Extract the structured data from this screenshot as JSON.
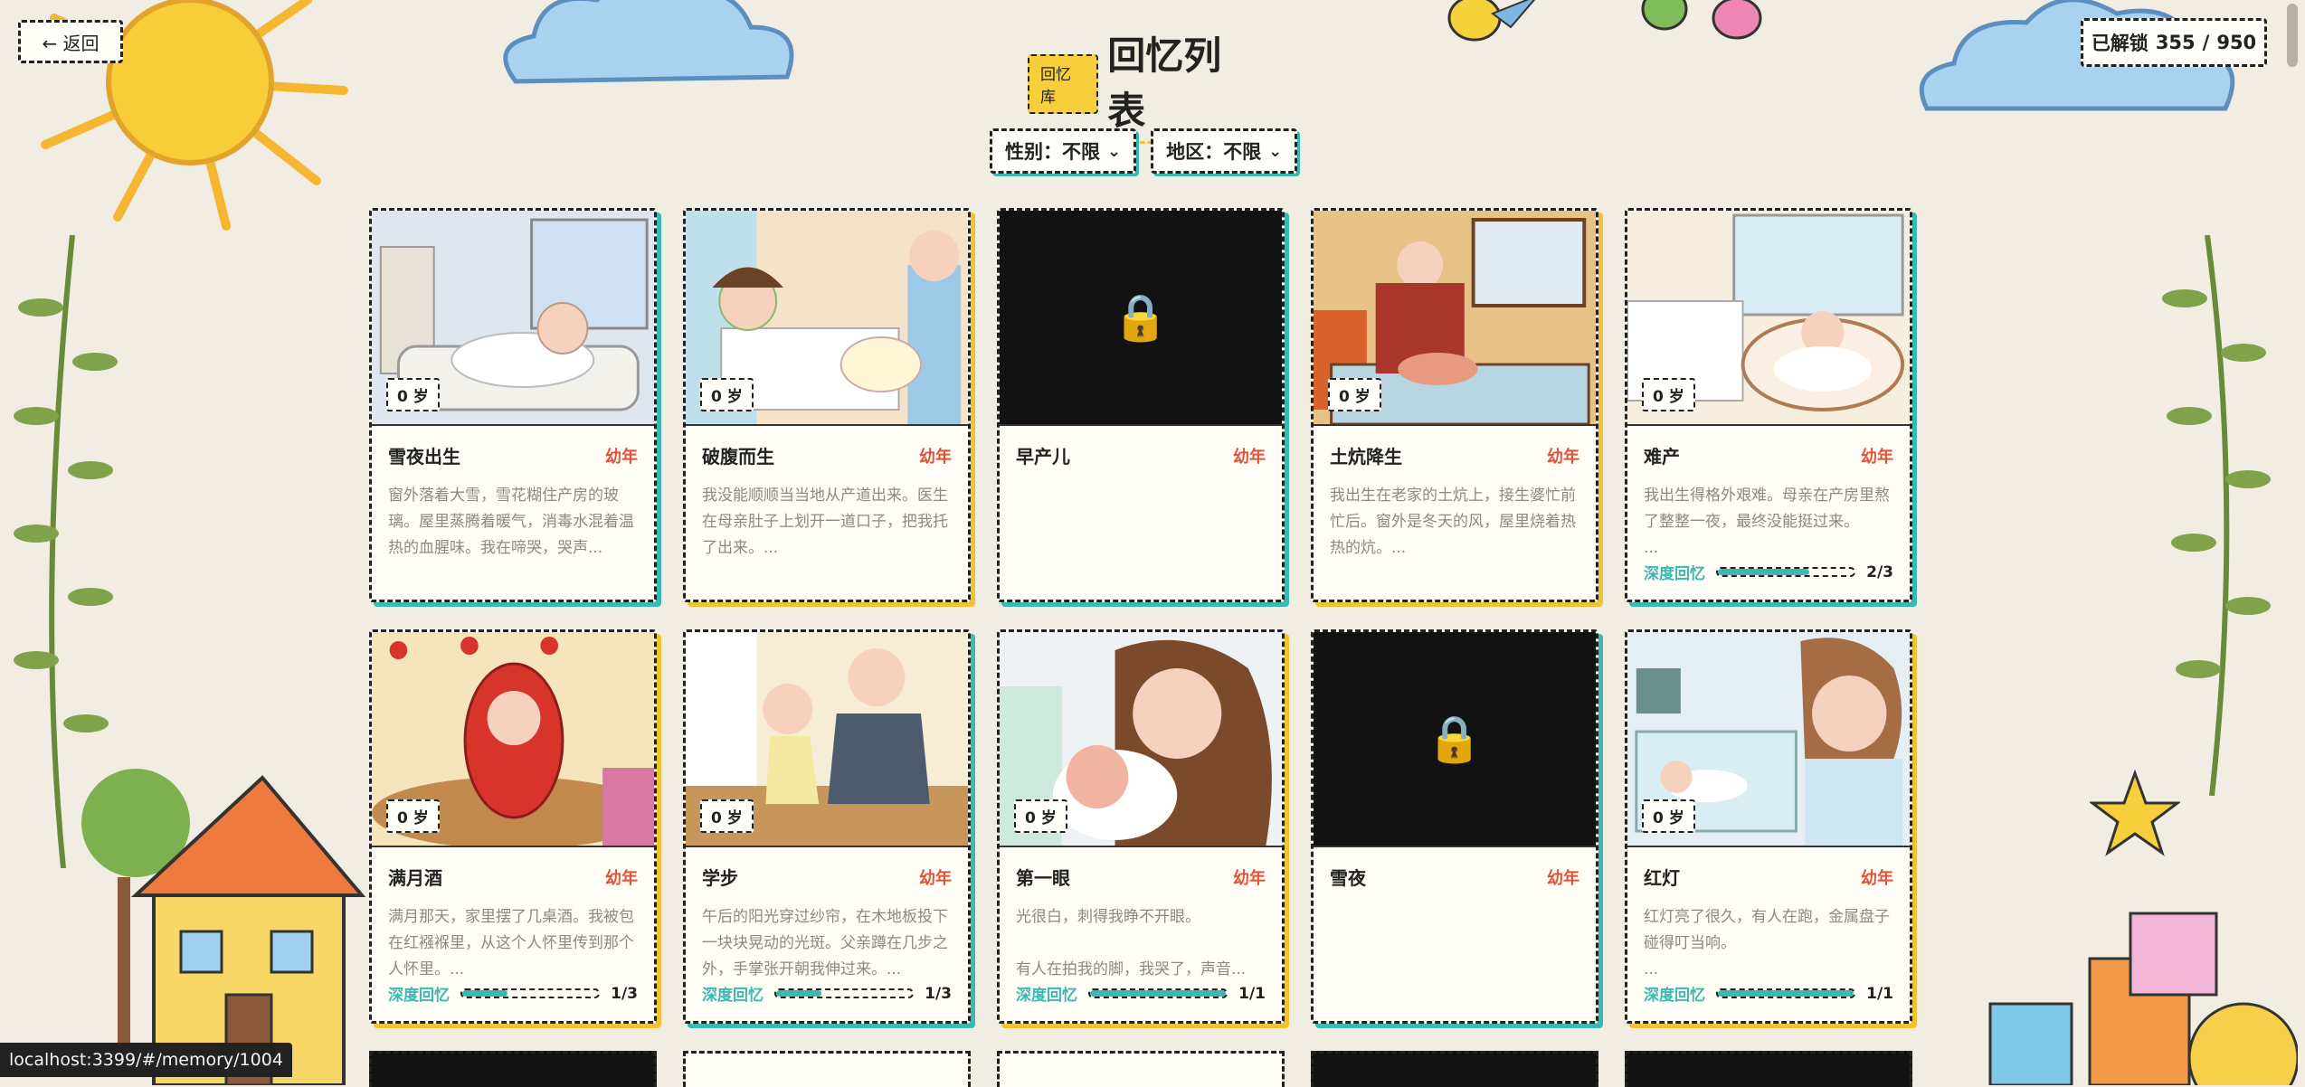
{
  "header": {
    "back_label": "← 返回",
    "tag": "回忆库",
    "title": "回忆列表",
    "unlocked_label": "已解锁",
    "unlocked_count": "355",
    "separator": "/",
    "total_count": "950"
  },
  "filters": [
    {
      "label": "性别：不限",
      "icon": "chevron-down-icon"
    },
    {
      "label": "地区：不限",
      "icon": "chevron-down-icon"
    }
  ],
  "cards": [
    {
      "title": "雪夜出生",
      "stage": "幼年",
      "age": "0 岁",
      "locked": false,
      "scene": "hospital-snow",
      "desc": "窗外落着大雪，雪花糊住产房的玻璃。屋里蒸腾着暖气，消毒水混着温热的血腥味。我在啼哭，哭声...",
      "deep": false
    },
    {
      "title": "破腹而生",
      "stage": "幼年",
      "age": "0 岁",
      "locked": false,
      "scene": "mother-nurse",
      "desc": "我没能顺顺当当地从产道出来。医生在母亲肚子上划开一道口子，把我托了出来。...",
      "deep": false
    },
    {
      "title": "早产儿",
      "stage": "幼年",
      "age": "",
      "locked": true,
      "desc": "",
      "deep": false
    },
    {
      "title": "土炕降生",
      "stage": "幼年",
      "age": "0 岁",
      "locked": false,
      "scene": "kang",
      "desc": "我出生在老家的土炕上，接生婆忙前忙后。窗外是冬天的风，屋里烧着热热的炕。...",
      "deep": false
    },
    {
      "title": "难产",
      "stage": "幼年",
      "age": "0 岁",
      "locked": false,
      "scene": "crib",
      "desc": "我出生得格外艰难。母亲在产房里熬了整整一夜，最终没能挺过来。\n...",
      "deep": true,
      "deep_label": "深度回忆",
      "deep_count": "2/3",
      "deep_progress": 0.67
    },
    {
      "title": "满月酒",
      "stage": "幼年",
      "age": "0 岁",
      "locked": false,
      "scene": "feast",
      "desc": "满月那天，家里摆了几桌酒。我被包在红襁褓里，从这个人怀里传到那个人怀里。...",
      "deep": true,
      "deep_label": "深度回忆",
      "deep_count": "1/3",
      "deep_progress": 0.33
    },
    {
      "title": "学步",
      "stage": "幼年",
      "age": "0 岁",
      "locked": false,
      "scene": "walking",
      "desc": "午后的阳光穿过纱帘，在木地板投下一块块晃动的光斑。父亲蹲在几步之外，手掌张开朝我伸过来。...",
      "deep": true,
      "deep_label": "深度回忆",
      "deep_count": "1/3",
      "deep_progress": 0.33
    },
    {
      "title": "第一眼",
      "stage": "幼年",
      "age": "0 岁",
      "locked": false,
      "scene": "first-look",
      "desc": "光很白，刺得我睁不开眼。\n\n有人在拍我的脚，我哭了，声音...",
      "deep": true,
      "deep_label": "深度回忆",
      "deep_count": "1/1",
      "deep_progress": 1.0
    },
    {
      "title": "雪夜",
      "stage": "幼年",
      "age": "",
      "locked": true,
      "desc": "",
      "deep": false
    },
    {
      "title": "红灯",
      "stage": "幼年",
      "age": "0 岁",
      "locked": false,
      "scene": "incubator",
      "desc": "红灯亮了很久，有人在跑，金属盘子碰得叮当响。\n...",
      "deep": true,
      "deep_label": "深度回忆",
      "deep_count": "1/1",
      "deep_progress": 1.0
    }
  ],
  "status_url": "localhost:3399/#/memory/1004",
  "colors": {
    "accent_teal": "#3bb8b0",
    "accent_yellow": "#f1c232",
    "stage_red": "#e0533a",
    "lock": "#f59a2c"
  }
}
